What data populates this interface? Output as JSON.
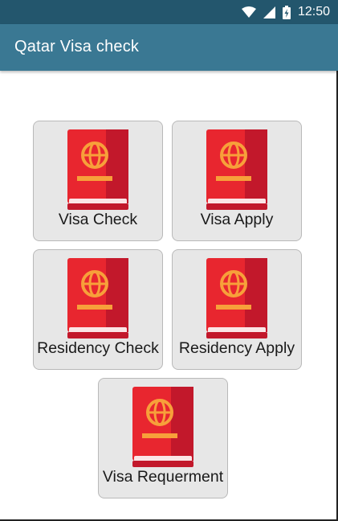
{
  "status_bar": {
    "time": "12:50",
    "icons": [
      "wifi-icon",
      "signal-icon",
      "battery-charging-icon"
    ]
  },
  "app_bar": {
    "title": "Qatar Visa check"
  },
  "menu": {
    "items": [
      {
        "label": "Visa Check",
        "icon": "passport-icon"
      },
      {
        "label": "Visa Apply",
        "icon": "passport-icon"
      },
      {
        "label": "Residency Check",
        "icon": "passport-icon"
      },
      {
        "label": "Residency Apply",
        "icon": "passport-icon"
      },
      {
        "label": "Visa Requerment",
        "icon": "passport-icon"
      }
    ]
  },
  "colors": {
    "status_bar": "#23566d",
    "app_bar": "#3a7893",
    "passport_cover": "#e8262f",
    "passport_accent": "#f7a03a",
    "tile_background": "#e7e7e7"
  }
}
